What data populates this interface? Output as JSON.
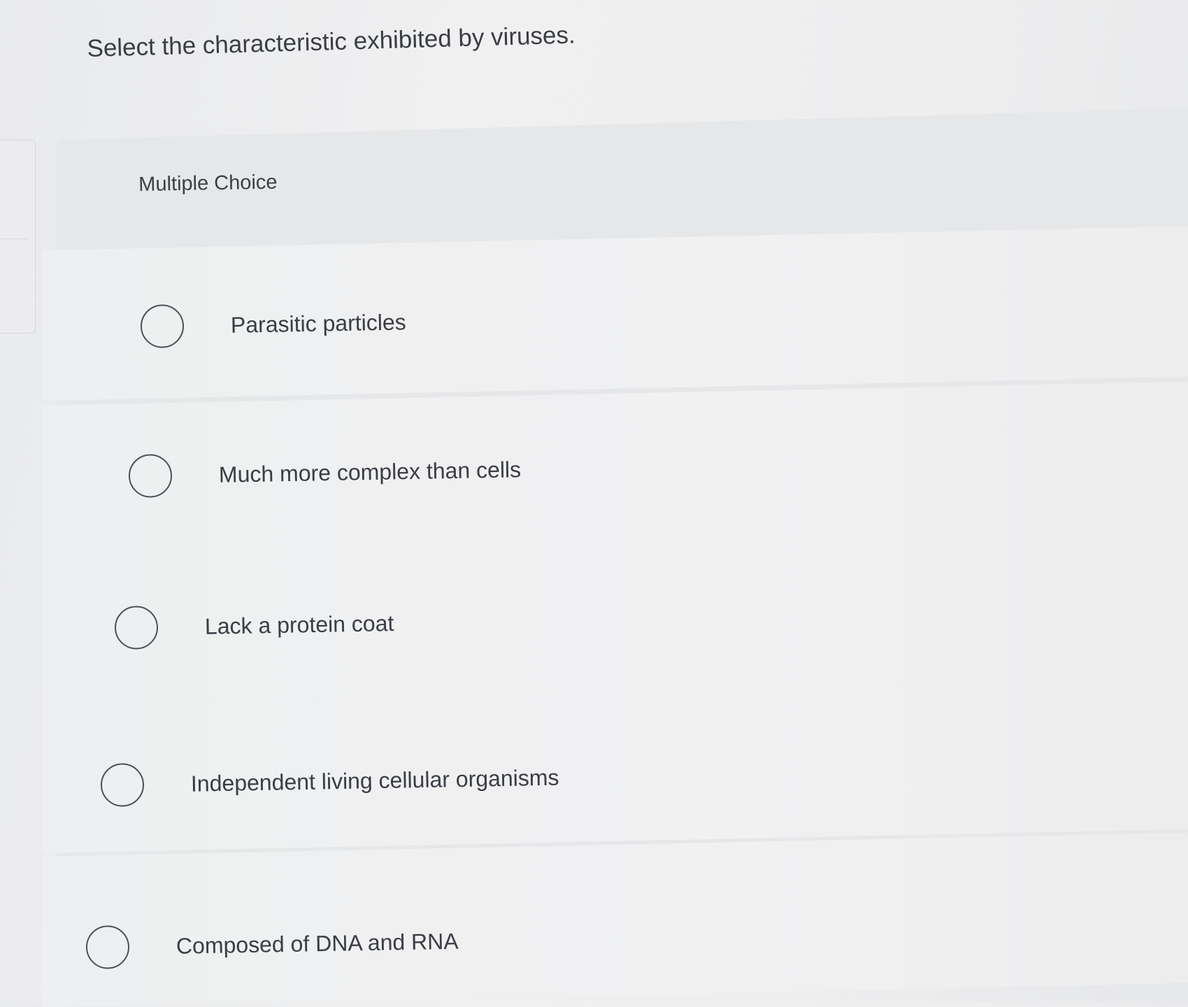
{
  "question": {
    "text": "Select the characteristic exhibited by viruses."
  },
  "answer_block": {
    "type_label": "Multiple Choice",
    "options": [
      {
        "label": "Parasitic particles",
        "selected": false
      },
      {
        "label": "Much more complex than cells",
        "selected": false
      },
      {
        "label": "Lack a protein coat",
        "selected": false
      },
      {
        "label": "Independent living cellular organisms",
        "selected": false
      },
      {
        "label": "Composed of DNA and RNA",
        "selected": false
      }
    ]
  }
}
